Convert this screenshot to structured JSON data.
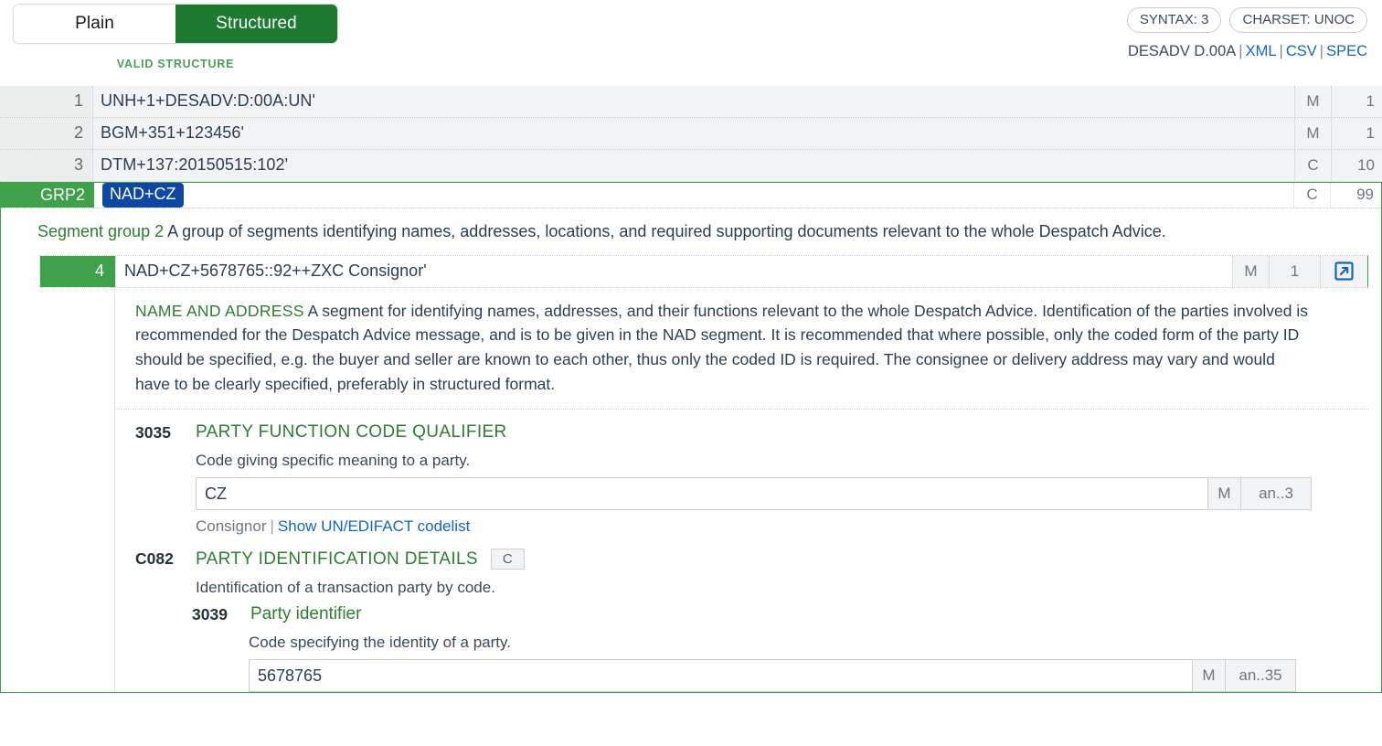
{
  "toolbar": {
    "tab_plain": "Plain",
    "tab_structured": "Structured",
    "validation_status": "VALID STRUCTURE",
    "chip_syntax": "SYNTAX: 3",
    "chip_charset": "CHARSET: UNOC",
    "message_type": "DESADV D.00A",
    "link_xml": "XML",
    "link_csv": "CSV",
    "link_spec": "SPEC",
    "separator": "|"
  },
  "colors": {
    "accent_green": "#1e7a30",
    "row_green": "#3fa24a",
    "badge_blue": "#0d47a1",
    "link_blue": "#1565c0",
    "title_green": "#2e7d32"
  },
  "segments": [
    {
      "line": "1",
      "text": "UNH+1+DESADV:D:00A:UN'",
      "mc": "M",
      "rep": "1"
    },
    {
      "line": "2",
      "text": "BGM+351+123456'",
      "mc": "M",
      "rep": "1"
    },
    {
      "line": "3",
      "text": "DTM+137:20150515:102'",
      "mc": "C",
      "rep": "10"
    }
  ],
  "group": {
    "tag": "GRP2",
    "badge": "NAD+CZ",
    "mc": "C",
    "rep": "99",
    "desc_name": "Segment group 2",
    "desc_text": "A group of segments identifying names, addresses, locations, and required supporting documents relevant to the whole Despatch Advice.",
    "segment": {
      "line": "4",
      "text": "NAD+CZ+5678765::92++ZXC Consignor'",
      "mc": "M",
      "rep": "1",
      "open_icon": "external-link-icon",
      "desc_name": "NAME AND ADDRESS",
      "desc_text": "A segment for identifying names, addresses, and their functions relevant to the whole Despatch Advice. Identification of the parties involved is recommended for the Despatch Advice message, and is to be given in the NAD segment. It is recommended that where possible, only the coded form of the party ID should be specified, e.g. the buyer and seller are known to each other, thus only the coded ID is required. The consignee or delivery address may vary and would have to be clearly specified, preferably in structured format.",
      "fields": [
        {
          "code": "3035",
          "title": "PARTY FUNCTION CODE QUALIFIER",
          "desc": "Code giving specific meaning to a party.",
          "value": "CZ",
          "mc": "M",
          "format": "an..3",
          "foot_value": "Consignor",
          "foot_link": "Show UN/EDIFACT codelist"
        },
        {
          "code": "C082",
          "title": "PARTY IDENTIFICATION DETAILS",
          "flag": "C",
          "desc": "Identification of a transaction party by code.",
          "child": {
            "code": "3039",
            "title": "Party identifier",
            "desc": "Code specifying the identity of a party.",
            "value": "5678765",
            "mc": "M",
            "format": "an..35"
          }
        }
      ]
    }
  }
}
